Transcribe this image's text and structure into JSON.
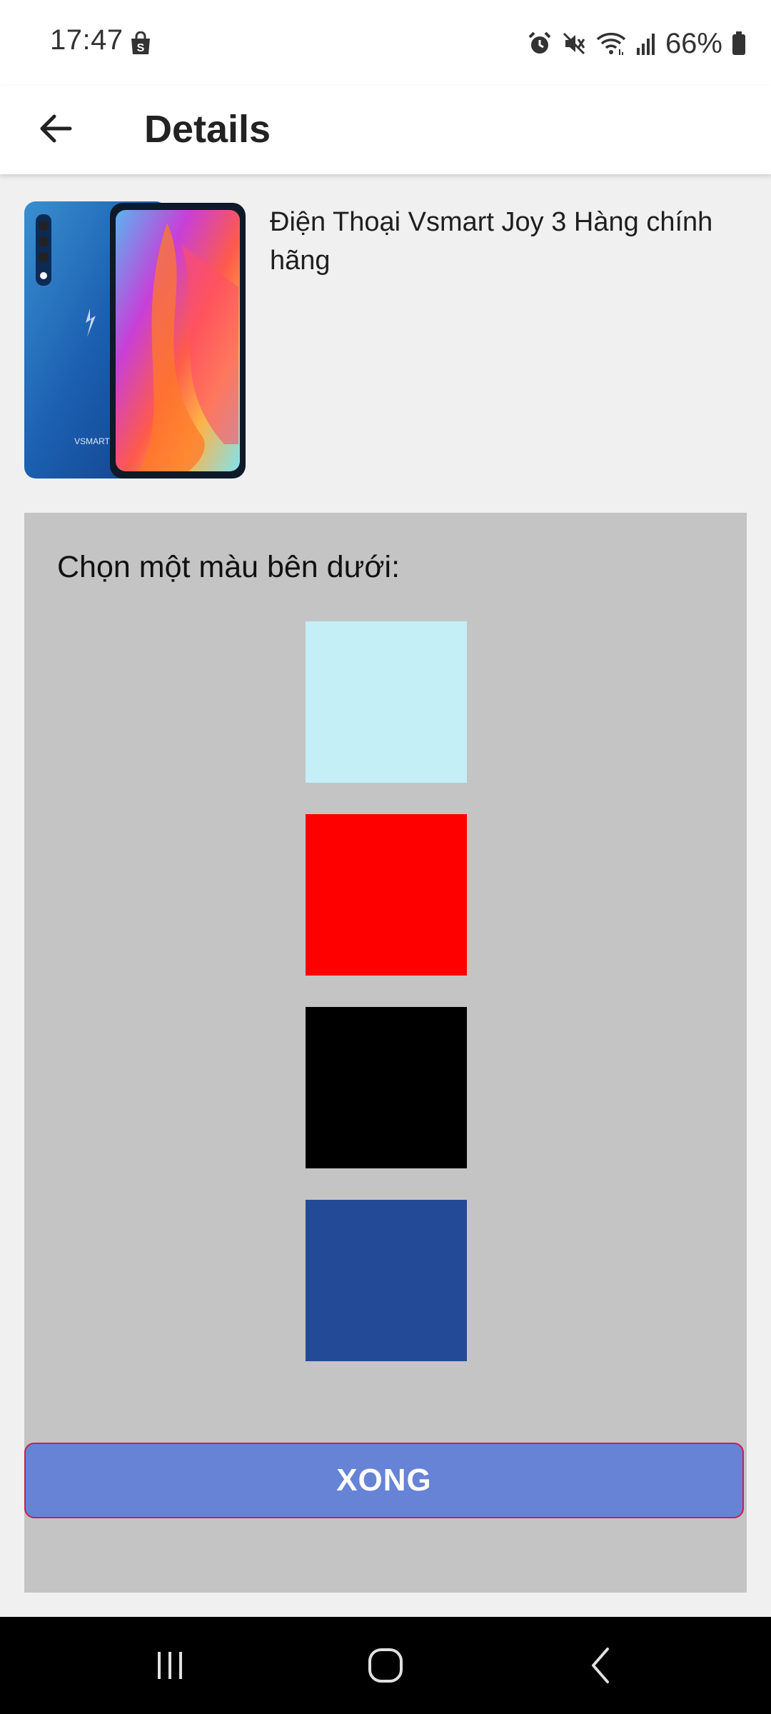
{
  "status_bar": {
    "time": "17:47",
    "battery": "66%",
    "icons": [
      "shopping-bag-icon",
      "alarm-icon",
      "vibrate-mute-icon",
      "wifi-icon",
      "signal-icon",
      "battery-icon"
    ]
  },
  "app_bar": {
    "title": "Details",
    "back_icon": "arrow-left-icon"
  },
  "product": {
    "name": "Điện Thoại Vsmart Joy 3 Hàng chính hãng",
    "image_brand_text": "VSMART"
  },
  "color_picker": {
    "label": "Chọn một màu bên dưới:",
    "swatches": [
      {
        "name": "light-cyan",
        "color": "#c4eff7"
      },
      {
        "name": "red",
        "color": "#ff0000"
      },
      {
        "name": "black",
        "color": "#000000"
      },
      {
        "name": "dark-blue",
        "color": "#234a96"
      }
    ],
    "done_label": "XONG"
  },
  "theme": {
    "panel_bg": "#c4c4c4",
    "button_bg": "#6783d6",
    "button_border": "#c8214e"
  },
  "nav_bar": {
    "icons": [
      "recent-apps-icon",
      "home-icon",
      "back-icon"
    ]
  }
}
